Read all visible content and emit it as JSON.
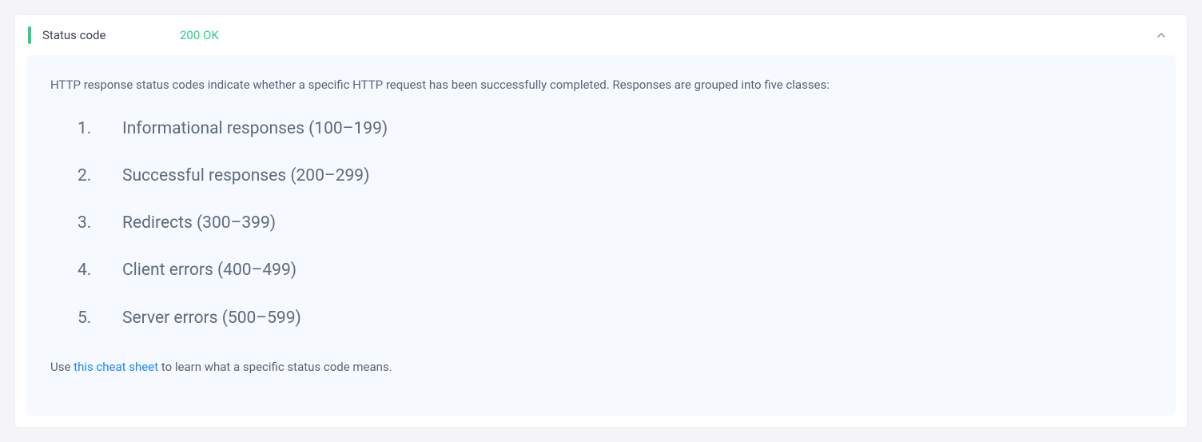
{
  "header": {
    "label": "Status code",
    "value": "200 OK"
  },
  "body": {
    "intro": "HTTP response status codes indicate whether a specific HTTP request has been successfully completed. Responses are grouped into five classes:",
    "items": [
      "Informational responses (100–199)",
      "Successful responses (200–299)",
      "Redirects (300–399)",
      "Client errors (400–499)",
      "Server errors (500–599)"
    ],
    "footer_prefix": "Use ",
    "footer_link": "this cheat sheet",
    "footer_suffix": " to learn what a specific status code means."
  }
}
